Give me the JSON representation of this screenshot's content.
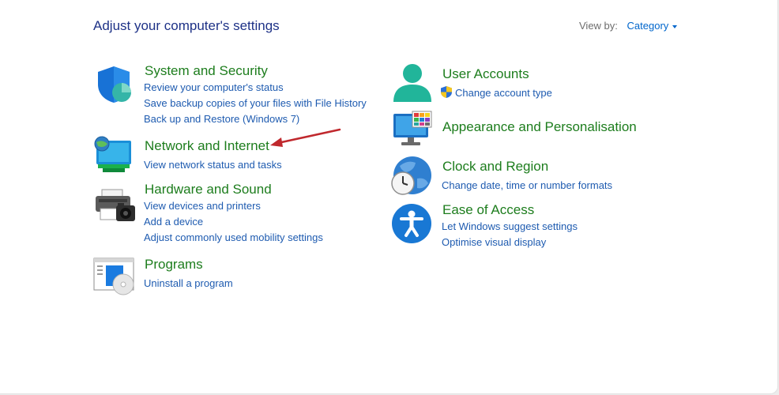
{
  "header": {
    "title": "Adjust your computer's settings",
    "view_by_label": "View by:",
    "view_by_value": "Category"
  },
  "left_categories": [
    {
      "title": "System and Security",
      "icon": "shield-icon",
      "links": [
        "Review your computer's status",
        "Save backup copies of your files with File History",
        "Back up and Restore (Windows 7)"
      ]
    },
    {
      "title": "Network and Internet",
      "icon": "network-globe-icon",
      "links": [
        "View network status and tasks"
      ]
    },
    {
      "title": "Hardware and Sound",
      "icon": "printer-camera-icon",
      "links": [
        "View devices and printers",
        "Add a device",
        "Adjust commonly used mobility settings"
      ]
    },
    {
      "title": "Programs",
      "icon": "programs-disc-icon",
      "links": [
        "Uninstall a program"
      ]
    }
  ],
  "right_categories": [
    {
      "title": "User Accounts",
      "icon": "user-icon",
      "links": [
        "Change account type"
      ]
    },
    {
      "title": "Appearance and Personalisation",
      "icon": "monitor-palette-icon",
      "links": []
    },
    {
      "title": "Clock and Region",
      "icon": "globe-clock-icon",
      "links": [
        "Change date, time or number formats"
      ]
    },
    {
      "title": "Ease of Access",
      "icon": "accessibility-icon",
      "links": [
        "Let Windows suggest settings",
        "Optimise visual display"
      ]
    }
  ],
  "colors": {
    "title_blue": "#1e3287",
    "category_green": "#1d7d1d",
    "link_blue": "#1e5bb0",
    "annotation_red": "#c0282d"
  }
}
